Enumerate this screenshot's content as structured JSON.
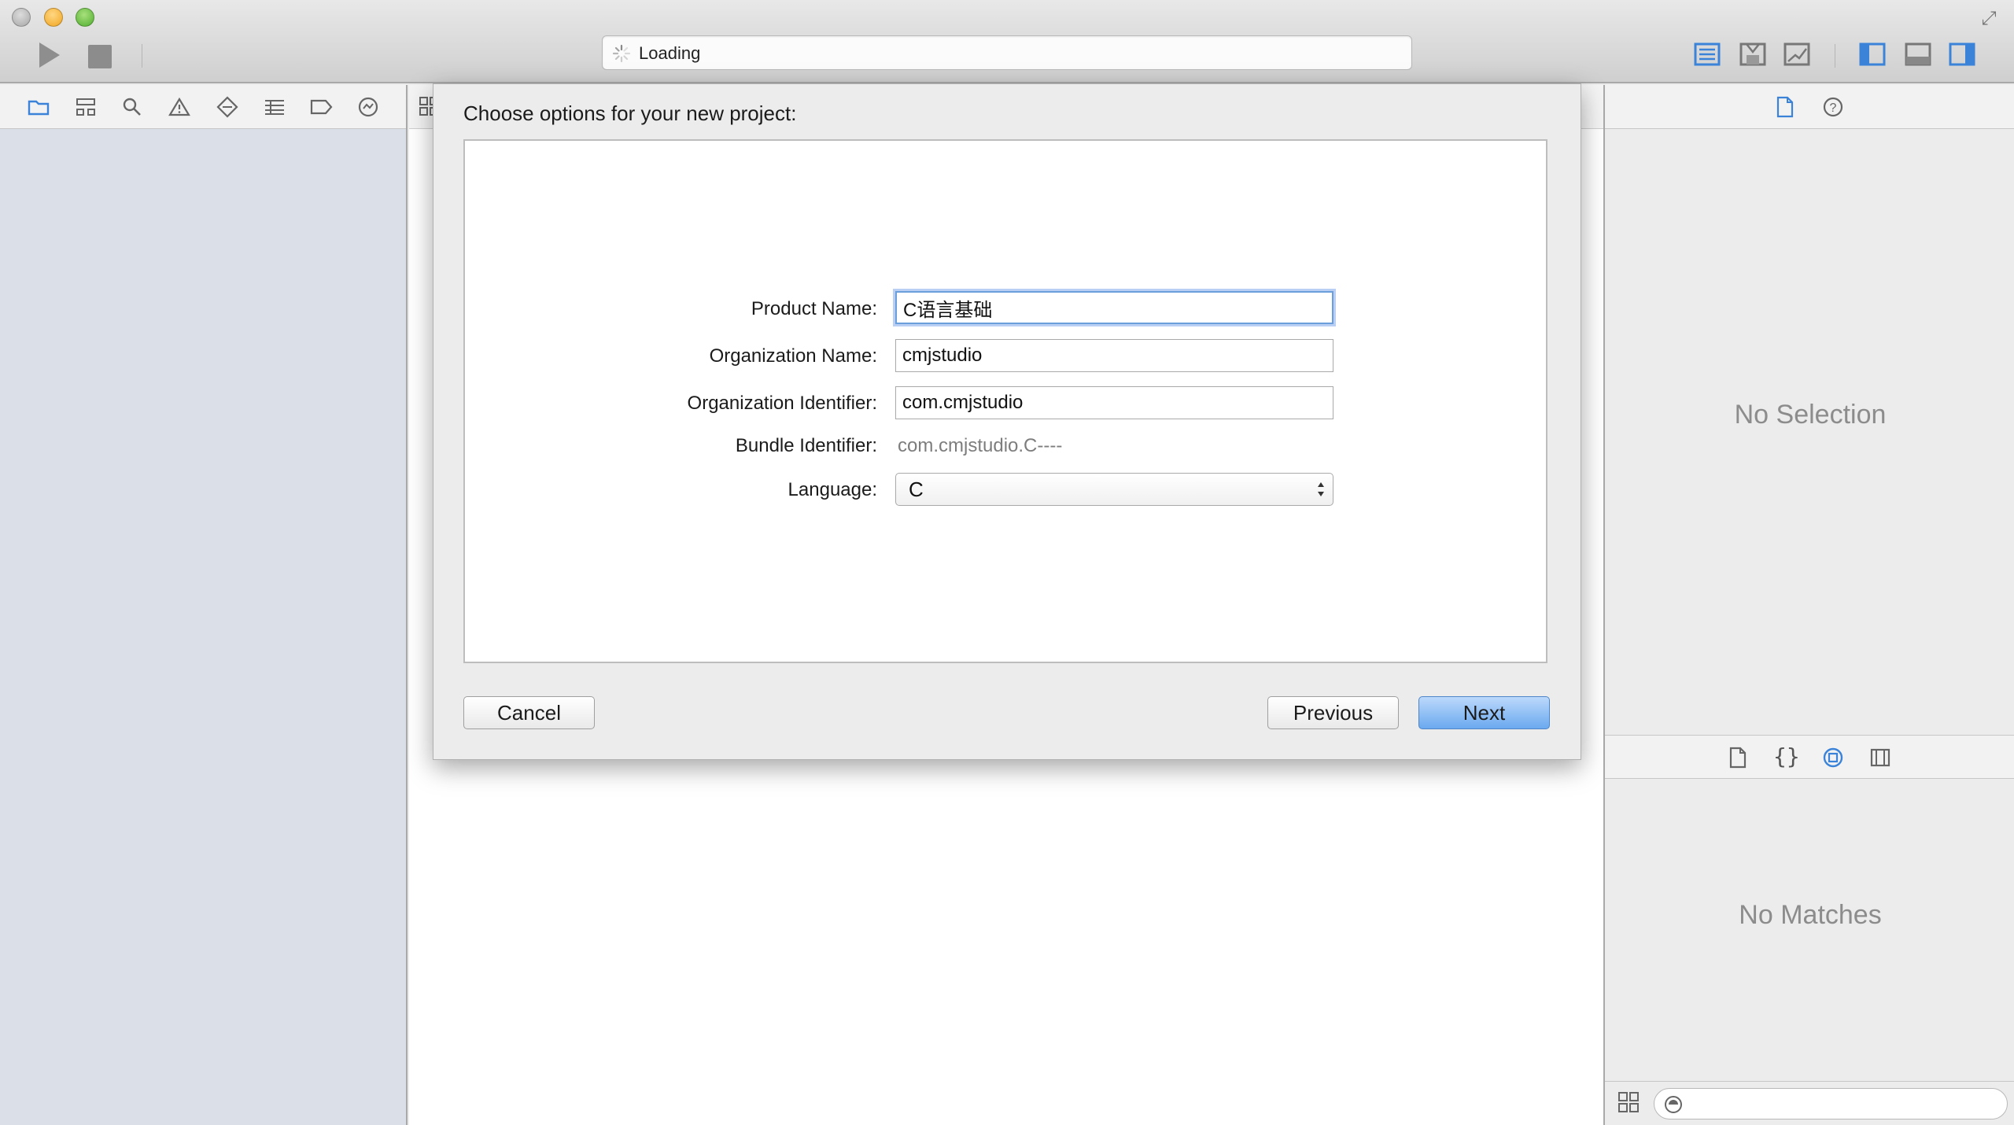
{
  "toolbar": {
    "activity_text": "Loading"
  },
  "navigator": {
    "tabs": [
      "folder-icon",
      "hierarchy-icon",
      "search-icon",
      "warning-icon",
      "diamond-icon",
      "list-icon",
      "tag-icon",
      "report-icon"
    ]
  },
  "dialog": {
    "title": "Choose options for your new project:",
    "fields": {
      "product_name": {
        "label": "Product Name:",
        "value": "C语言基础"
      },
      "organization_name": {
        "label": "Organization Name:",
        "value": "cmjstudio"
      },
      "organization_identifier": {
        "label": "Organization Identifier:",
        "value": "com.cmjstudio"
      },
      "bundle_identifier": {
        "label": "Bundle Identifier:",
        "value": "com.cmjstudio.C----"
      },
      "language": {
        "label": "Language:",
        "value": "C"
      }
    },
    "buttons": {
      "cancel": "Cancel",
      "previous": "Previous",
      "next": "Next"
    }
  },
  "inspector": {
    "empty_text": "No Selection"
  },
  "library": {
    "empty_text": "No Matches"
  },
  "colors": {
    "accent": "#6ba9ef",
    "focus_ring": "#6a9fdc",
    "navigator_bg": "#dbe0e8",
    "selected_tab": "#3a83d8"
  }
}
